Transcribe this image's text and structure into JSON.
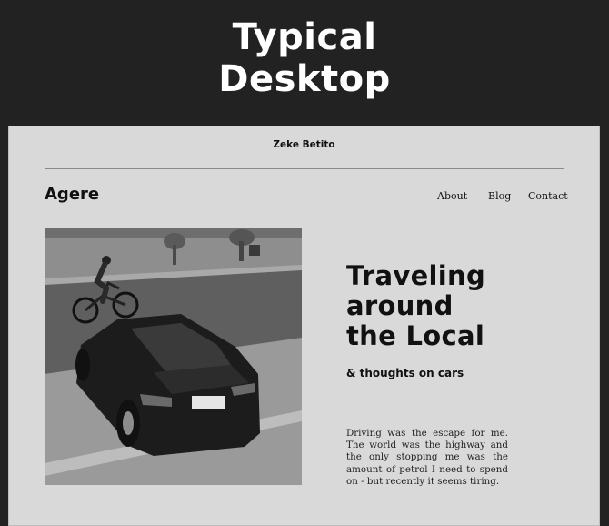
{
  "hero": {
    "line1": "Typical",
    "line2": "Desktop"
  },
  "header": {
    "author": "Zeke Betito"
  },
  "site": {
    "brand": "Agere",
    "nav": [
      {
        "label": "About"
      },
      {
        "label": "Blog"
      },
      {
        "label": "Contact"
      }
    ]
  },
  "article": {
    "title_lines": [
      "Traveling",
      "around",
      "the Local"
    ],
    "subtitle": "& thoughts on cars",
    "body": "Driving was the escape for me. The world was the highway and the only stopping me was the amount of petrol I need to spend on - but recently it seems tiring."
  },
  "colors": {
    "outer_background": "#222222",
    "page_background": "#d9d9d9",
    "text": "#111111",
    "hero_text": "#ffffff"
  }
}
